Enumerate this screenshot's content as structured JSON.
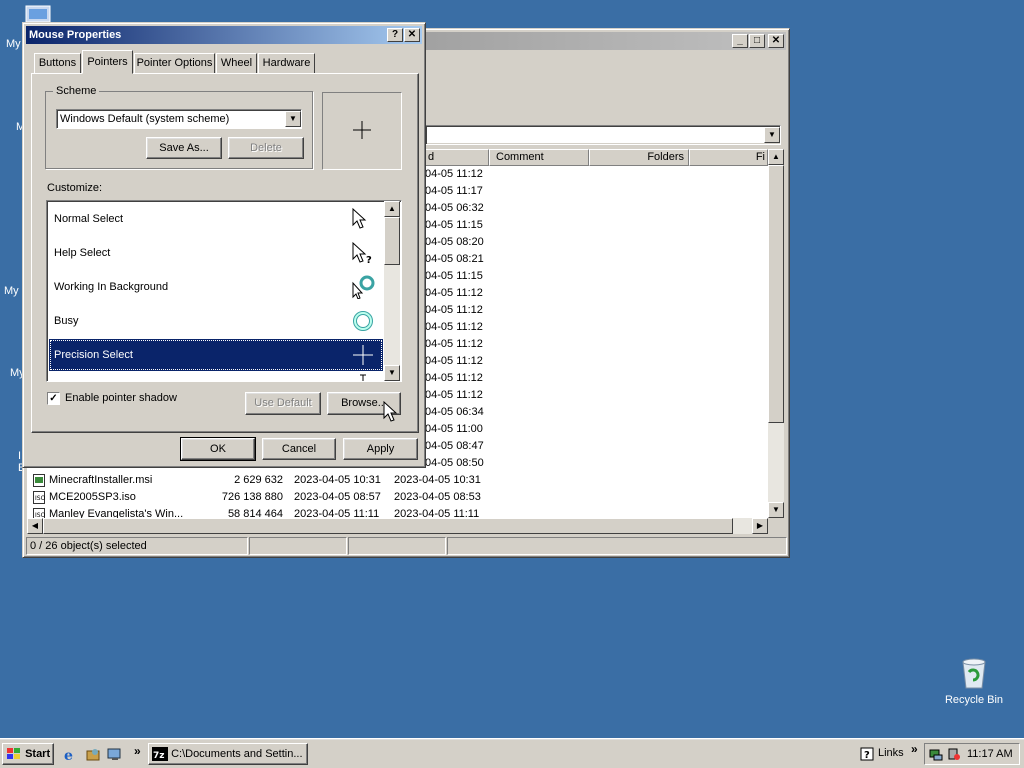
{
  "desktop": {
    "fragments": [
      "My",
      "M",
      "My",
      "My",
      "I",
      "E"
    ],
    "recycle_bin_label": "Recycle Bin"
  },
  "explorer": {
    "columns": [
      "d",
      "Comment",
      "Folders",
      "Fi"
    ],
    "modified_dates": [
      "04-05 11:12",
      "04-05 11:17",
      "04-05 06:32",
      "04-05 11:15",
      "04-05 08:20",
      "04-05 08:21",
      "04-05 11:15",
      "04-05 11:12",
      "04-05 11:12",
      "04-05 11:12",
      "04-05 11:12",
      "04-05 11:12",
      "04-05 11:12",
      "04-05 11:12",
      "04-05 06:34",
      "04-05 11:00",
      "04-05 08:47",
      "04-05 08:50"
    ],
    "files": [
      {
        "name": "MinecraftInstaller.msi",
        "size": "2 629 632",
        "date1": "2023-04-05 10:31",
        "date2": "2023-04-05 10:31"
      },
      {
        "name": "MCE2005SP3.iso",
        "size": "726 138 880",
        "date1": "2023-04-05 08:57",
        "date2": "2023-04-05 08:53"
      },
      {
        "name": "Manley Evangelista's Win...",
        "size": "58 814 464",
        "date1": "2023-04-05 11:11",
        "date2": "2023-04-05 11:11"
      }
    ],
    "status": "0 / 26 object(s) selected"
  },
  "dialog": {
    "title": "Mouse Properties",
    "help_label": "?",
    "close_label": "✕",
    "tabs": [
      "Buttons",
      "Pointers",
      "Pointer Options",
      "Wheel",
      "Hardware"
    ],
    "scheme_label": "Scheme",
    "scheme_value": "Windows Default (system scheme)",
    "save_as_label": "Save As...",
    "delete_label": "Delete",
    "customize_label": "Customize:",
    "cursors": [
      {
        "label": "Normal Select",
        "icon": "arrow-cursor-icon"
      },
      {
        "label": "Help Select",
        "icon": "help-cursor-icon"
      },
      {
        "label": "Working In Background",
        "icon": "working-cursor-icon"
      },
      {
        "label": "Busy",
        "icon": "busy-cursor-icon"
      },
      {
        "label": "Precision Select",
        "icon": "crosshair-cursor-icon"
      }
    ],
    "enable_shadow_label": "Enable pointer shadow",
    "enable_shadow_checked": true,
    "use_default_label": "Use Default",
    "browse_label": "Browse...",
    "ok_label": "OK",
    "cancel_label": "Cancel",
    "apply_label": "Apply"
  },
  "taskbar": {
    "start_label": "Start",
    "quicklaunch_chevron": "»",
    "task_button_label": "C:\\Documents and Settin...",
    "links_label": "Links",
    "links_chevron": "»",
    "clock": "11:17 AM"
  },
  "colors": {
    "desktop": "#3a6ea5",
    "selection": "#0a246a",
    "face": "#d4d0c8"
  }
}
